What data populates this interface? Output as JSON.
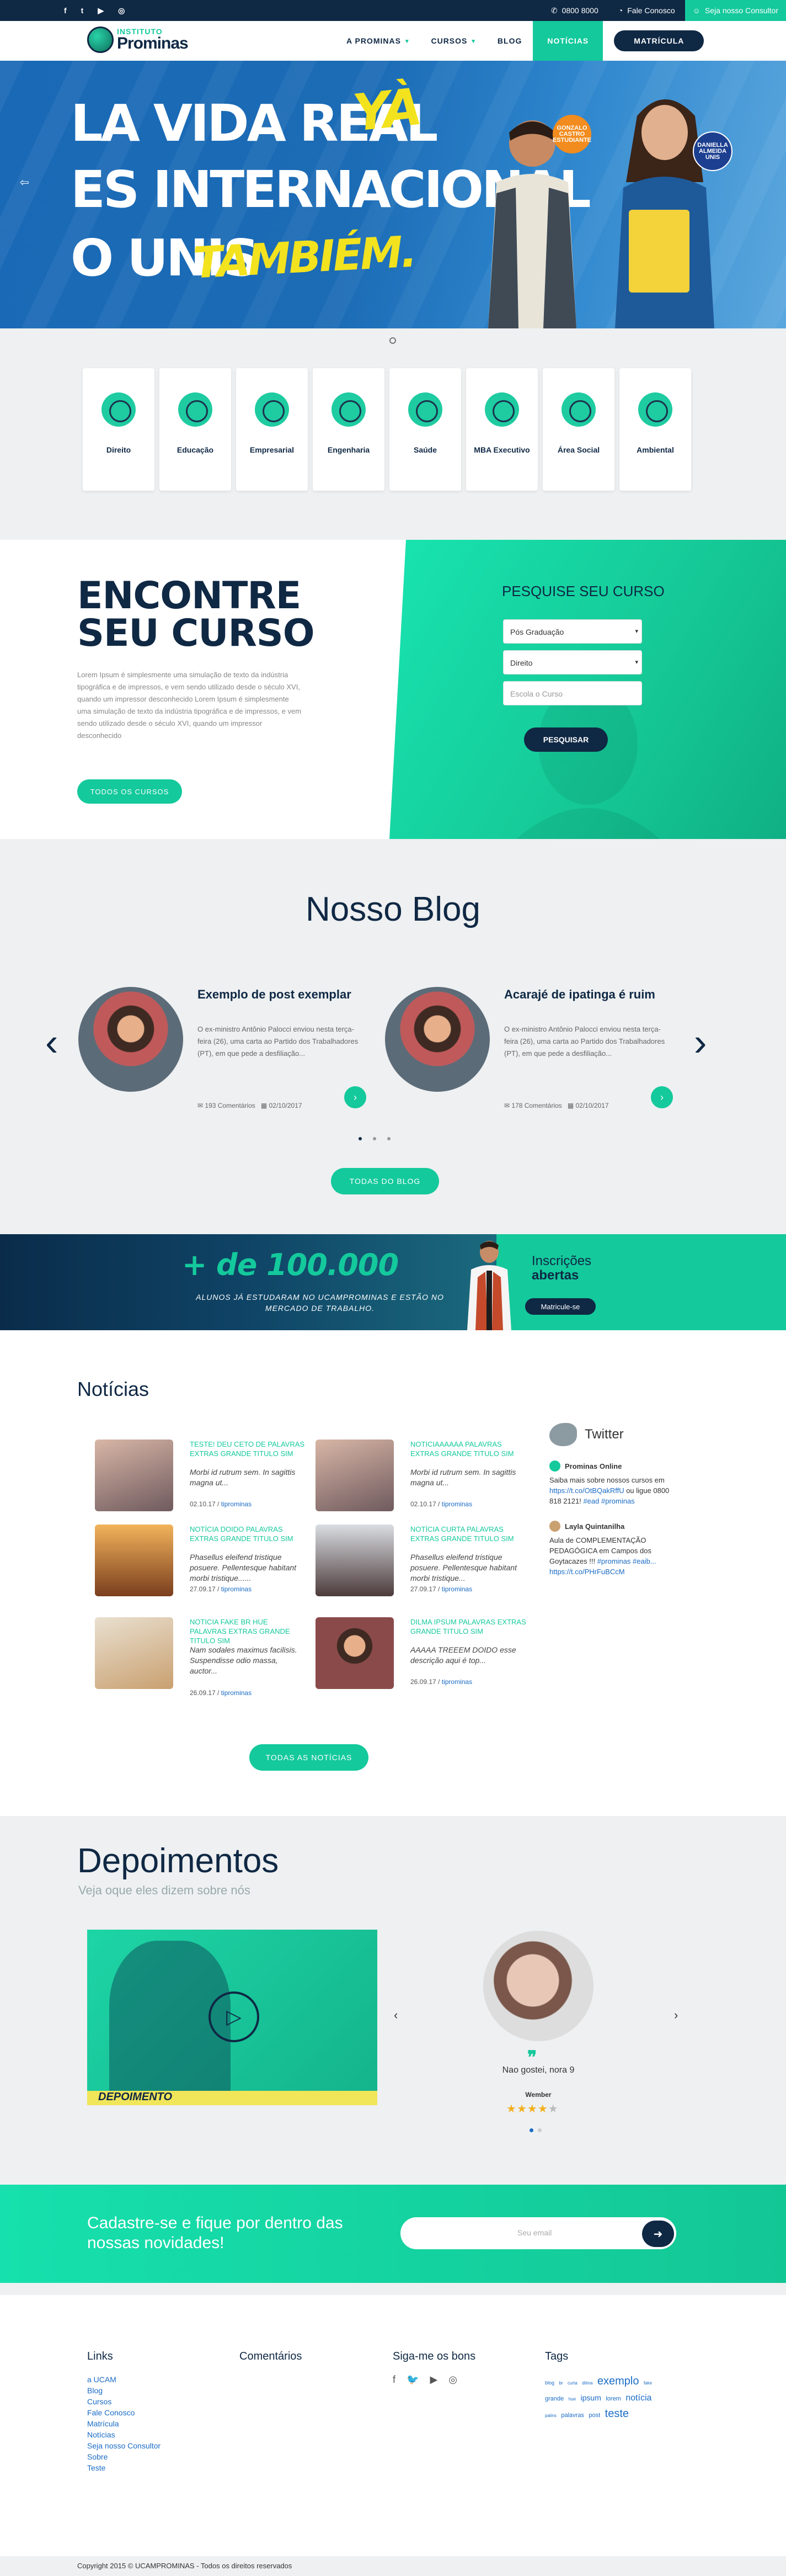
{
  "topbar": {
    "social": [
      "f",
      "t",
      "▶",
      "◎"
    ],
    "phone": "0800 8000",
    "contact": "Fale Conosco",
    "consultant": "Seja nosso Consultor"
  },
  "nav": {
    "logo_top": "INSTITUTO",
    "logo_bottom": "Prominas",
    "items": [
      "A PROMINAS",
      "CURSOS",
      "BLOG",
      "NOTÍCIAS"
    ],
    "cta": "MATRÍCULA"
  },
  "hero": {
    "line1": "LA VIDA REAL",
    "line1_accent": "YÀ",
    "line2": "ES INTERNACIONAL",
    "line3": "O UNIS",
    "line3_accent": "TAMBIÉM.",
    "badge1": "GONZALO CASTRO ESTUDIANTE",
    "badge2": "DANIELLA ALMEIDA UNIS"
  },
  "areas": [
    {
      "label": "Direito"
    },
    {
      "label": "Educação"
    },
    {
      "label": "Empresarial"
    },
    {
      "label": "Engenharia"
    },
    {
      "label": "Saúde"
    },
    {
      "label": "MBA Executivo"
    },
    {
      "label": "Área Social"
    },
    {
      "label": "Ambiental"
    }
  ],
  "find": {
    "title_1": "ENCONTRE",
    "title_2": "SEU CURSO",
    "text": "Lorem Ipsum é simplesmente uma simulação de texto da indústria tipográfica e de impressos, e vem sendo utilizado desde o século XVI, quando um impressor desconhecido Lorem Ipsum é simplesmente uma simulação de texto da indústria tipográfica e de impressos, e vem sendo utilizado desde o século XVI, quando um impressor desconhecido",
    "all_courses": "TODOS OS CURSOS",
    "panel_title": "PESQUISE SEU CURSO",
    "select_1": "Pós Graduação",
    "select_2": "Direito",
    "input_placeholder": "Escola o Curso",
    "search": "PESQUISAR"
  },
  "blog": {
    "title": "Nosso Blog",
    "posts": [
      {
        "title": "Exemplo de post exemplar",
        "desc": "O ex-ministro Antônio Palocci enviou nesta terça-feira (26), uma carta ao Partido dos Trabalhadores (PT), em que pede a desfiliação...",
        "comments": "193 Comentários",
        "date": "02/10/2017"
      },
      {
        "title": "Acarajé de ipatinga é ruim",
        "desc": "O ex-ministro Antônio Palocci enviou nesta terça-feira (26), uma carta ao Partido dos Trabalhadores (PT), em que pede a desfiliação...",
        "comments": "178 Comentários",
        "date": "02/10/2017"
      }
    ],
    "all": "TODAS DO BLOG"
  },
  "promo": {
    "big": "+ de 100.000",
    "small": "ALUNOS JÁ ESTUDARAM NO UCAMPROMINAS E ESTÃO NO MERCADO DE TRABALHO.",
    "ins_1": "Inscrições",
    "ins_2": "abertas",
    "btn": "Matricule-se"
  },
  "news": {
    "title": "Notícias",
    "items": [
      {
        "title": "TESTE! DEU CETO DE PALAVRAS EXTRAS GRANDE TITULO SIM",
        "desc": "Morbi id rutrum sem. In sagittis magna ut...",
        "date": "02.10.17",
        "author": "tiprominas"
      },
      {
        "title": "NOTICIAAAAAA PALAVRAS EXTRAS GRANDE TITULO SIM",
        "desc": "Morbi id rutrum sem. In sagittis magna ut...",
        "date": "02.10.17",
        "author": "tiprominas"
      },
      {
        "title": "NOTÍCIA DOIDO PALAVRAS EXTRAS GRANDE TITULO SIM",
        "desc": "Phasellus eleifend tristique posuere. Pellentesque habitant morbi tristique......",
        "date": "27.09.17",
        "author": "tiprominas"
      },
      {
        "title": "NOTÍCIA CURTA PALAVRAS EXTRAS GRANDE TITULO SIM",
        "desc": "Phasellus eleifend tristique posuere. Pellentesque habitant morbi tristique...",
        "date": "27.09.17",
        "author": "tiprominas"
      },
      {
        "title": "NOTICIA FAKE BR HUE PALAVRAS EXTRAS GRANDE TITULO SIM",
        "desc": "Nam sodales maximus facilisis. Suspendisse odio massa, auctor...",
        "date": "26.09.17",
        "author": "tiprominas"
      },
      {
        "title": "DILMA IPSUM PALAVRAS EXTRAS GRANDE TITULO SIM",
        "desc": "AAAAA TREEEM DOIDO esse descrição aqui é top...",
        "date": "26.09.17",
        "author": "tiprominas"
      }
    ],
    "all": "TODAS AS NOTÍCIAS",
    "twitter": {
      "title": "Twitter",
      "tweets": [
        {
          "user": "Prominas Online",
          "text": "Saiba mais sobre nossos cursos em ",
          "link": "https://t.co/OtBQakRffU",
          "rest": " ou ligue 0800 818 2121! ",
          "tags": "#ead #prominas"
        },
        {
          "user": "Layla Quintanilha",
          "text": "Aula de COMPLEMENTAÇÃO PEDAGÓGICA em Campos dos Goytacazes !!! ",
          "link": "#prominas #eaib... https://t.co/PHrFuBCcM",
          "rest": "",
          "tags": ""
        }
      ]
    }
  },
  "dep": {
    "title": "Depoimentos",
    "subtitle": "Veja oque eles dizem sobre nós",
    "video_caption": "DEPOIMENTO",
    "quote": "Nao gostei, nora 9",
    "name": "Wember",
    "stars": 4
  },
  "newsletter": {
    "text": "Cadastre-se e fique por dentro das nossas novidades!",
    "placeholder": "Seu email"
  },
  "footer": {
    "links_title": "Links",
    "links": [
      "a UCAM",
      "Blog",
      "Cursos",
      "Fale Conosco",
      "Matrícula",
      "Notícias",
      "Seja nosso Consultor",
      "Sobre",
      "Teste"
    ],
    "comments_title": "Comentários",
    "social_title": "Siga-me os bons",
    "tags_title": "Tags",
    "tags": [
      {
        "t": "blog",
        "s": 9
      },
      {
        "t": "br",
        "s": 8
      },
      {
        "t": "curta",
        "s": 8
      },
      {
        "t": "dilma",
        "s": 8
      },
      {
        "t": "exemplo",
        "s": 20
      },
      {
        "t": "fake",
        "s": 8
      },
      {
        "t": "grande",
        "s": 11
      },
      {
        "t": "hue",
        "s": 8
      },
      {
        "t": "ipsum",
        "s": 14
      },
      {
        "t": "lorem",
        "s": 11
      },
      {
        "t": "notícia",
        "s": 16
      },
      {
        "t": "palins",
        "s": 8
      },
      {
        "t": "palavras",
        "s": 11
      },
      {
        "t": "post",
        "s": 11
      },
      {
        "t": "teste",
        "s": 20
      }
    ]
  },
  "copyright": "Copyright 2015 © UCAMPROMINAS - Todos os direitos reservados"
}
